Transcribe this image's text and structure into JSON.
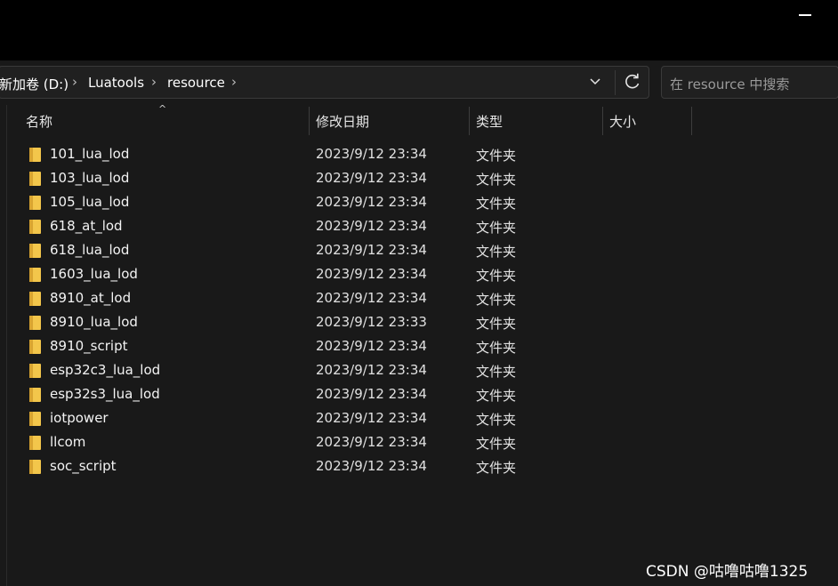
{
  "window": {
    "minimize_label": "minimize"
  },
  "breadcrumb": {
    "items": [
      "新加卷 (D:)",
      "Luatools",
      "resource"
    ],
    "separator": "›"
  },
  "search": {
    "placeholder": "在 resource 中搜索"
  },
  "columns": {
    "name": "名称",
    "date": "修改日期",
    "type": "类型",
    "size": "大小"
  },
  "files": [
    {
      "name": "101_lua_lod",
      "date": "2023/9/12 23:34",
      "type": "文件夹"
    },
    {
      "name": "103_lua_lod",
      "date": "2023/9/12 23:34",
      "type": "文件夹"
    },
    {
      "name": "105_lua_lod",
      "date": "2023/9/12 23:34",
      "type": "文件夹"
    },
    {
      "name": "618_at_lod",
      "date": "2023/9/12 23:34",
      "type": "文件夹"
    },
    {
      "name": "618_lua_lod",
      "date": "2023/9/12 23:34",
      "type": "文件夹"
    },
    {
      "name": "1603_lua_lod",
      "date": "2023/9/12 23:34",
      "type": "文件夹"
    },
    {
      "name": "8910_at_lod",
      "date": "2023/9/12 23:34",
      "type": "文件夹"
    },
    {
      "name": "8910_lua_lod",
      "date": "2023/9/12 23:33",
      "type": "文件夹"
    },
    {
      "name": "8910_script",
      "date": "2023/9/12 23:34",
      "type": "文件夹"
    },
    {
      "name": "esp32c3_lua_lod",
      "date": "2023/9/12 23:34",
      "type": "文件夹"
    },
    {
      "name": "esp32s3_lua_lod",
      "date": "2023/9/12 23:34",
      "type": "文件夹"
    },
    {
      "name": "iotpower",
      "date": "2023/9/12 23:34",
      "type": "文件夹"
    },
    {
      "name": "llcom",
      "date": "2023/9/12 23:34",
      "type": "文件夹"
    },
    {
      "name": "soc_script",
      "date": "2023/9/12 23:34",
      "type": "文件夹"
    }
  ],
  "watermark": "CSDN @咕噜咕噜1325",
  "colors": {
    "folder": "#f3c64b",
    "folder_dark": "#d9a531",
    "background": "#191919"
  }
}
